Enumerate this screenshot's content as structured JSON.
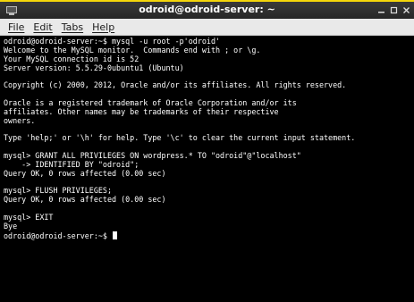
{
  "window": {
    "title": "odroid@odroid-server: ~",
    "accent_color": "#f5d60a"
  },
  "menu": {
    "items": [
      "File",
      "Edit",
      "Tabs",
      "Help"
    ]
  },
  "terminal": {
    "lines": [
      "odroid@odroid-server:~$ mysql -u root -p'odroid'",
      "Welcome to the MySQL monitor.  Commands end with ; or \\g.",
      "Your MySQL connection id is 52",
      "Server version: 5.5.29-0ubuntu1 (Ubuntu)",
      "",
      "Copyright (c) 2000, 2012, Oracle and/or its affiliates. All rights reserved.",
      "",
      "Oracle is a registered trademark of Oracle Corporation and/or its",
      "affiliates. Other names may be trademarks of their respective",
      "owners.",
      "",
      "Type 'help;' or '\\h' for help. Type '\\c' to clear the current input statement.",
      "",
      "mysql> GRANT ALL PRIVILEGES ON wordpress.* TO \"odroid\"@\"localhost\"",
      "    -> IDENTIFIED BY \"odroid\";",
      "Query OK, 0 rows affected (0.00 sec)",
      "",
      "mysql> FLUSH PRIVILEGES;",
      "Query OK, 0 rows affected (0.00 sec)",
      "",
      "mysql> EXIT",
      "Bye"
    ],
    "prompt": "odroid@odroid-server:~$ "
  }
}
